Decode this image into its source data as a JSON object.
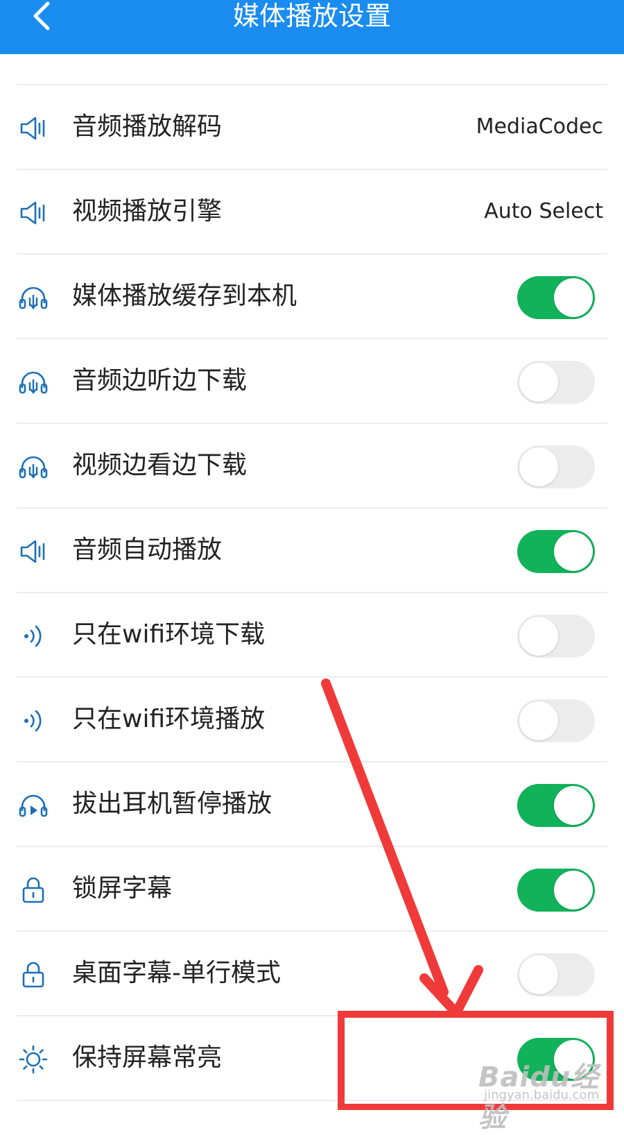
{
  "header": {
    "title": "媒体播放设置",
    "back_icon": "chevron-left-icon",
    "background": "#1a8cf0"
  },
  "settings": [
    {
      "id": "audio-decode",
      "label": "音频播放解码",
      "icon": "speaker-icon",
      "type": "value",
      "value": "MediaCodec"
    },
    {
      "id": "video-engine",
      "label": "视频播放引擎",
      "icon": "speaker-icon",
      "type": "value",
      "value": "Auto Select"
    },
    {
      "id": "media-cache",
      "label": "媒体播放缓存到本机",
      "icon": "headphones-download-icon",
      "type": "toggle",
      "on": true
    },
    {
      "id": "audio-stream-download",
      "label": "音频边听边下载",
      "icon": "headphones-download-icon",
      "type": "toggle",
      "on": false
    },
    {
      "id": "video-stream-download",
      "label": "视频边看边下载",
      "icon": "headphones-download-icon",
      "type": "toggle",
      "on": false
    },
    {
      "id": "audio-autoplay",
      "label": "音频自动播放",
      "icon": "speaker-icon",
      "type": "toggle",
      "on": true
    },
    {
      "id": "wifi-only-download",
      "label": "只在wifi环境下载",
      "icon": "wifi-signal-icon",
      "type": "toggle",
      "on": false
    },
    {
      "id": "wifi-only-play",
      "label": "只在wifi环境播放",
      "icon": "wifi-signal-icon",
      "type": "toggle",
      "on": false
    },
    {
      "id": "unplug-pause",
      "label": "拔出耳机暂停播放",
      "icon": "headphones-play-icon",
      "type": "toggle",
      "on": true
    },
    {
      "id": "lockscreen-subtitle",
      "label": "锁屏字幕",
      "icon": "lock-icon",
      "type": "toggle",
      "on": true
    },
    {
      "id": "desktop-subtitle-single",
      "label": "桌面字幕-单行模式",
      "icon": "lock-icon",
      "type": "toggle",
      "on": false
    },
    {
      "id": "keep-screen-on",
      "label": "保持屏幕常亮",
      "icon": "sun-icon",
      "type": "toggle",
      "on": true
    }
  ],
  "colors": {
    "toggle_on": "#11b25a",
    "toggle_off": "#ececec",
    "icon": "#1a6fb8",
    "annotation": "#f03a3a"
  },
  "watermark": {
    "brand": "Baidu经验",
    "site": "jingyan.baidu.com"
  }
}
